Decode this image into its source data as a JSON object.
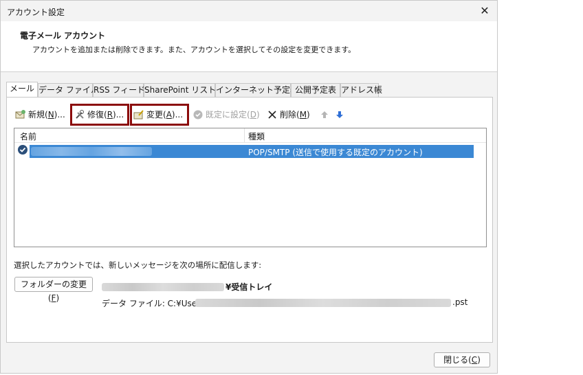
{
  "window": {
    "title": "アカウント設定"
  },
  "header": {
    "title": "電子メール アカウント",
    "description": "アカウントを追加または削除できます。また、アカウントを選択してその設定を変更できます。"
  },
  "tabs": [
    {
      "label": "メール"
    },
    {
      "label": "データ ファイル"
    },
    {
      "label": "RSS フィード"
    },
    {
      "label": "SharePoint リスト"
    },
    {
      "label": "インターネット予定表"
    },
    {
      "label": "公開予定表"
    },
    {
      "label": "アドレス帳"
    }
  ],
  "toolbar": {
    "new_label": "新規(",
    "new_key": "N",
    "new_tail": ")...",
    "repair_label": "修復(",
    "repair_key": "R",
    "repair_tail": ")...",
    "change_label": "変更(",
    "change_key": "A",
    "change_tail": ")...",
    "default_label": "既定に設定(",
    "default_key": "D",
    "default_tail": ")",
    "delete_label": "削除(",
    "delete_key": "M",
    "delete_tail": ")"
  },
  "list": {
    "col_name": "名前",
    "col_type": "種類",
    "rows": [
      {
        "type": "POP/SMTP (送信で使用する既定のアカウント)"
      }
    ]
  },
  "delivery": {
    "label": "選択したアカウントでは、新しいメッセージを次の場所に配信します:",
    "change_folder_label": "フォルダーの変更(",
    "change_folder_key": "F",
    "change_folder_tail": ")",
    "inbox_suffix": "¥受信トレイ",
    "data_file_prefix": "データ ファイル: C:¥Users¥",
    "data_file_suffix": ".pst"
  },
  "footer": {
    "close_label": "閉じる(",
    "close_key": "C",
    "close_tail": ")"
  },
  "colors": {
    "selection": "#3b88d4",
    "highlight_border": "#8b0a0a"
  }
}
